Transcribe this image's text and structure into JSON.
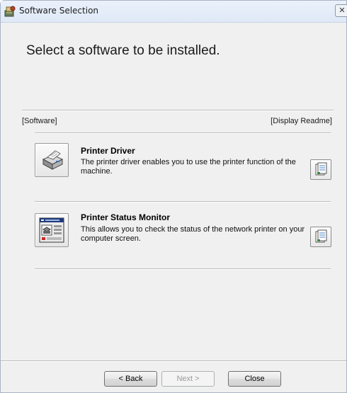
{
  "window": {
    "title": "Software Selection",
    "close_glyph": "✕",
    "app_icon": "setup-icon"
  },
  "heading": "Select a software to be installed.",
  "list_header": {
    "left": "[Software]",
    "right": "[Display Readme]"
  },
  "items": [
    {
      "title": "Printer Driver",
      "description": "The printer driver enables you to use the printer function of the machine.",
      "icon": "printer-icon",
      "readme_icon": "document-icon"
    },
    {
      "title": "Printer Status Monitor",
      "description": "This allows you to check the status of the network printer on your computer screen.",
      "icon": "status-monitor-icon",
      "readme_icon": "document-icon"
    }
  ],
  "buttons": {
    "back": "< Back",
    "next": "Next >",
    "close": "Close"
  }
}
